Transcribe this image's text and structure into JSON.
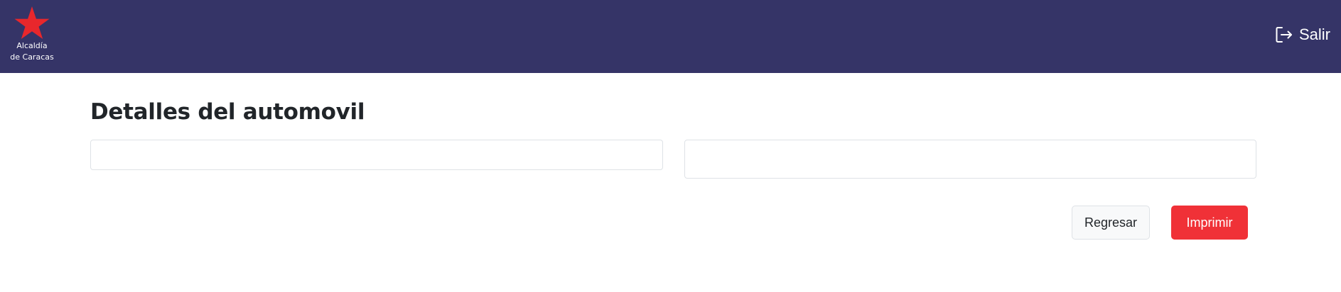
{
  "header": {
    "logo_text": "Alcaldía\nde Caracas",
    "logout_label": "Salir",
    "logout_icon": "logout-icon",
    "logo_icon": "red-star-icon",
    "background_color": "#353467",
    "star_color": "#e8272c"
  },
  "main": {
    "title": "Detalles del automovil",
    "fields": [
      {
        "value": "",
        "placeholder": ""
      },
      {
        "value": "",
        "placeholder": ""
      }
    ],
    "buttons": {
      "back_label": "Regresar",
      "print_label": "Imprimir"
    },
    "print_button_color": "#f03137"
  }
}
